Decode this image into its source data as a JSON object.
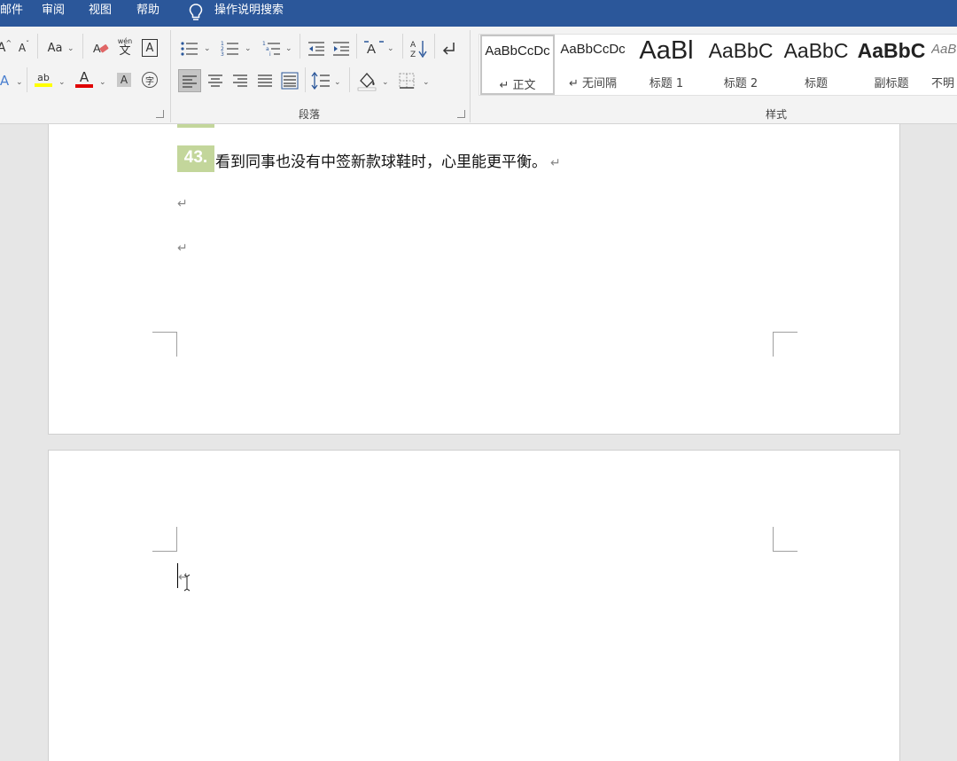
{
  "menu": {
    "items": [
      "邮件",
      "审阅",
      "视图",
      "帮助"
    ],
    "tell_me": "操作说明搜索"
  },
  "ribbon": {
    "font_group": {
      "grow_font": "A",
      "shrink_font": "A",
      "change_case": "Aa",
      "phonetic_guide": "文",
      "phonetic_top": "wén",
      "char_border": "A",
      "highlight_label": "ab",
      "font_color_label": "A",
      "char_shading": "A",
      "enclose_char": "字",
      "highlight_color": "#ffff00",
      "font_color": "#e00000"
    },
    "paragraph_group": {
      "label": "段落"
    },
    "styles_group": {
      "label": "样式",
      "items": [
        {
          "sample": "AaBbCcDc",
          "name": "↵ 正文",
          "selected": true
        },
        {
          "sample": "AaBbCcDc",
          "name": "↵ 无间隔",
          "selected": false
        },
        {
          "sample": "AaBl",
          "name": "标题 1",
          "selected": false
        },
        {
          "sample": "AaBbC",
          "name": "标题 2",
          "selected": false
        },
        {
          "sample": "AaBbC",
          "name": "标题",
          "selected": false
        },
        {
          "sample": "AaBbC",
          "name": "副标题",
          "selected": false
        },
        {
          "sample": "AaB",
          "name": "不明",
          "selected": false
        }
      ]
    }
  },
  "document": {
    "item_number": "43.",
    "item_text": "看到同事也没有中签新款球鞋时，心里能更平衡。",
    "para_mark": "↵",
    "accent_color": "#c3d69b"
  }
}
